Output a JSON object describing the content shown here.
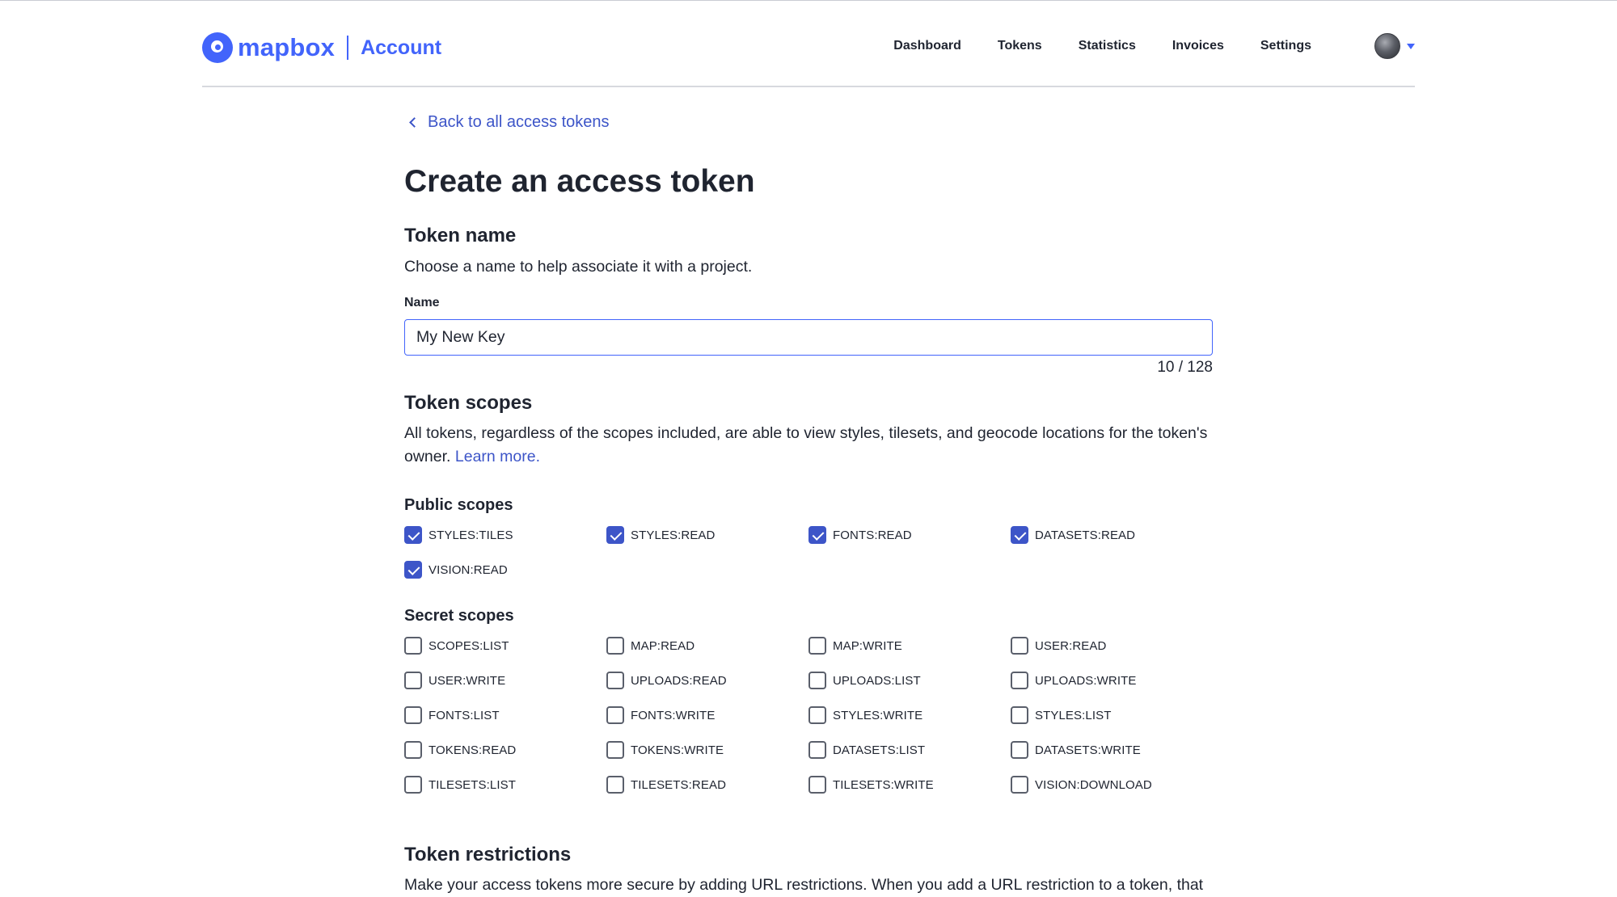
{
  "header": {
    "logo_text": "mapbox",
    "section": "Account",
    "nav": [
      "Dashboard",
      "Tokens",
      "Statistics",
      "Invoices",
      "Settings"
    ]
  },
  "back_link": "Back to all access tokens",
  "page_title": "Create an access token",
  "token_name": {
    "title": "Token name",
    "description": "Choose a name to help associate it with a project.",
    "field_label": "Name",
    "value": "My New Key",
    "char_count": "10 / 128"
  },
  "token_scopes": {
    "title": "Token scopes",
    "description": "All tokens, regardless of the scopes included, are able to view styles, tilesets, and geocode locations for the token's owner.",
    "learn_more": "Learn more.",
    "public_title": "Public scopes",
    "public": [
      {
        "label": "STYLES:TILES",
        "checked": true
      },
      {
        "label": "STYLES:READ",
        "checked": true
      },
      {
        "label": "FONTS:READ",
        "checked": true
      },
      {
        "label": "DATASETS:READ",
        "checked": true
      },
      {
        "label": "VISION:READ",
        "checked": true
      }
    ],
    "secret_title": "Secret scopes",
    "secret": [
      {
        "label": "SCOPES:LIST",
        "checked": false
      },
      {
        "label": "MAP:READ",
        "checked": false
      },
      {
        "label": "MAP:WRITE",
        "checked": false
      },
      {
        "label": "USER:READ",
        "checked": false
      },
      {
        "label": "USER:WRITE",
        "checked": false
      },
      {
        "label": "UPLOADS:READ",
        "checked": false
      },
      {
        "label": "UPLOADS:LIST",
        "checked": false
      },
      {
        "label": "UPLOADS:WRITE",
        "checked": false
      },
      {
        "label": "FONTS:LIST",
        "checked": false
      },
      {
        "label": "FONTS:WRITE",
        "checked": false
      },
      {
        "label": "STYLES:WRITE",
        "checked": false
      },
      {
        "label": "STYLES:LIST",
        "checked": false
      },
      {
        "label": "TOKENS:READ",
        "checked": false
      },
      {
        "label": "TOKENS:WRITE",
        "checked": false
      },
      {
        "label": "DATASETS:LIST",
        "checked": false
      },
      {
        "label": "DATASETS:WRITE",
        "checked": false
      },
      {
        "label": "TILESETS:LIST",
        "checked": false
      },
      {
        "label": "TILESETS:READ",
        "checked": false
      },
      {
        "label": "TILESETS:WRITE",
        "checked": false
      },
      {
        "label": "VISION:DOWNLOAD",
        "checked": false
      }
    ]
  },
  "token_restrictions": {
    "title": "Token restrictions",
    "description": "Make your access tokens more secure by adding URL restrictions. When you add a URL restriction to a token, that token will only work for requests that originate from the URLs you specify. Tokens without restrictions will work for"
  },
  "colors": {
    "accent": "#4264fb",
    "link": "#3d55c8",
    "text": "#1f2430"
  }
}
